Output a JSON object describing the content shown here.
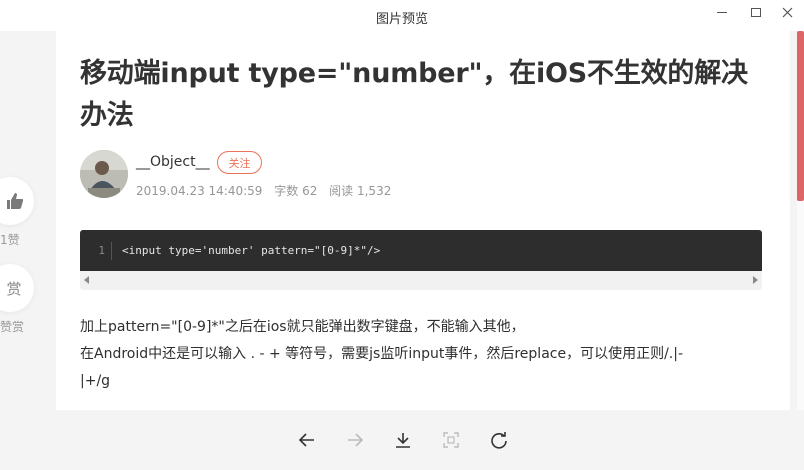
{
  "window": {
    "title": "图片预览"
  },
  "article": {
    "title": "移动端input type=\"number\"，在iOS不生效的解决办法",
    "author": "__Object__",
    "follow_label": "关注",
    "date": "2019.04.23 14:40:59",
    "word_count": "字数 62",
    "reads": "阅读 1,532",
    "code": {
      "line_number": "1",
      "line": "<input type='number' pattern=\"[0-9]*\"/>"
    },
    "paragraph_lines": [
      "加上pattern=\"[0-9]*\"之后在ios就只能弹出数字键盘，不能输入其他，",
      "在Android中还是可以输入 . - + 等符号，需要js监听input事件，然后replace，可以使用正则/.|-",
      "|+/g"
    ]
  },
  "side": {
    "like_count": "1赞",
    "reward_icon_text": "赏",
    "reward_label": "赞赏"
  },
  "toolbar": {
    "icons": [
      "arrow-left-icon",
      "arrow-right-icon",
      "download-icon",
      "fit-screen-icon",
      "rotate-icon"
    ]
  },
  "colors": {
    "accent": "#ec7259",
    "scroll_thumb": "#d94b4b",
    "code_bg": "#2d2d2d"
  }
}
